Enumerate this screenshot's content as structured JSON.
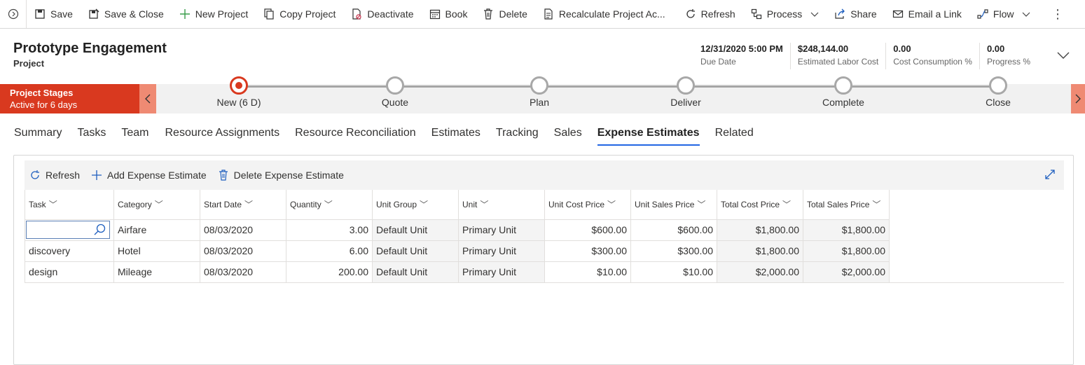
{
  "toolbar": {
    "items": [
      {
        "label": "Save",
        "icon": "save-icon"
      },
      {
        "label": "Save & Close",
        "icon": "save-close-icon"
      },
      {
        "label": "New Project",
        "icon": "plus-icon"
      },
      {
        "label": "Copy Project",
        "icon": "copy-icon"
      },
      {
        "label": "Deactivate",
        "icon": "deactivate-icon"
      },
      {
        "label": "Book",
        "icon": "calendar-icon"
      },
      {
        "label": "Delete",
        "icon": "trash-icon"
      },
      {
        "label": "Recalculate Project Ac...",
        "icon": "document-icon"
      },
      {
        "label": "Refresh",
        "icon": "refresh-icon"
      },
      {
        "label": "Process",
        "icon": "process-icon"
      },
      {
        "label": "Share",
        "icon": "share-icon"
      },
      {
        "label": "Email a Link",
        "icon": "email-icon"
      },
      {
        "label": "Flow",
        "icon": "flow-icon"
      }
    ],
    "more_label": "⋮"
  },
  "header": {
    "title": "Prototype Engagement",
    "entity": "Project",
    "fields": [
      {
        "value": "12/31/2020 5:00 PM",
        "label": "Due Date"
      },
      {
        "value": "$248,144.00",
        "label": "Estimated Labor Cost"
      },
      {
        "value": "0.00",
        "label": "Cost Consumption %"
      },
      {
        "value": "0.00",
        "label": "Progress %"
      }
    ]
  },
  "process": {
    "flag_title": "Project Stages",
    "flag_subtitle": "Active for 6 days",
    "stages": [
      {
        "label": "New  (6 D)",
        "active": true
      },
      {
        "label": "Quote",
        "active": false
      },
      {
        "label": "Plan",
        "active": false
      },
      {
        "label": "Deliver",
        "active": false
      },
      {
        "label": "Complete",
        "active": false
      },
      {
        "label": "Close",
        "active": false
      }
    ],
    "accent": "#d9391f"
  },
  "tabs": [
    "Summary",
    "Tasks",
    "Team",
    "Resource Assignments",
    "Resource Reconciliation",
    "Estimates",
    "Tracking",
    "Sales",
    "Expense Estimates",
    "Related"
  ],
  "selected_tab": "Expense Estimates",
  "grid": {
    "commands": [
      {
        "label": "Refresh",
        "icon": "refresh-icon"
      },
      {
        "label": "Add Expense Estimate",
        "icon": "plus-icon"
      },
      {
        "label": "Delete Expense Estimate",
        "icon": "trash-icon"
      }
    ],
    "columns": [
      "Task",
      "Category",
      "Start Date",
      "Quantity",
      "Unit Group",
      "Unit",
      "Unit Cost Price",
      "Unit Sales Price",
      "Total Cost Price",
      "Total Sales Price"
    ],
    "rows": [
      [
        "",
        "Airfare",
        "08/03/2020",
        "3.00",
        "Default Unit",
        "Primary Unit",
        "$600.00",
        "$600.00",
        "$1,800.00",
        "$1,800.00"
      ],
      [
        "discovery",
        "Hotel",
        "08/03/2020",
        "6.00",
        "Default Unit",
        "Primary Unit",
        "$300.00",
        "$300.00",
        "$1,800.00",
        "$1,800.00"
      ],
      [
        "design",
        "Mileage",
        "08/03/2020",
        "200.00",
        "Default Unit",
        "Primary Unit",
        "$10.00",
        "$10.00",
        "$2,000.00",
        "$2,000.00"
      ]
    ]
  }
}
